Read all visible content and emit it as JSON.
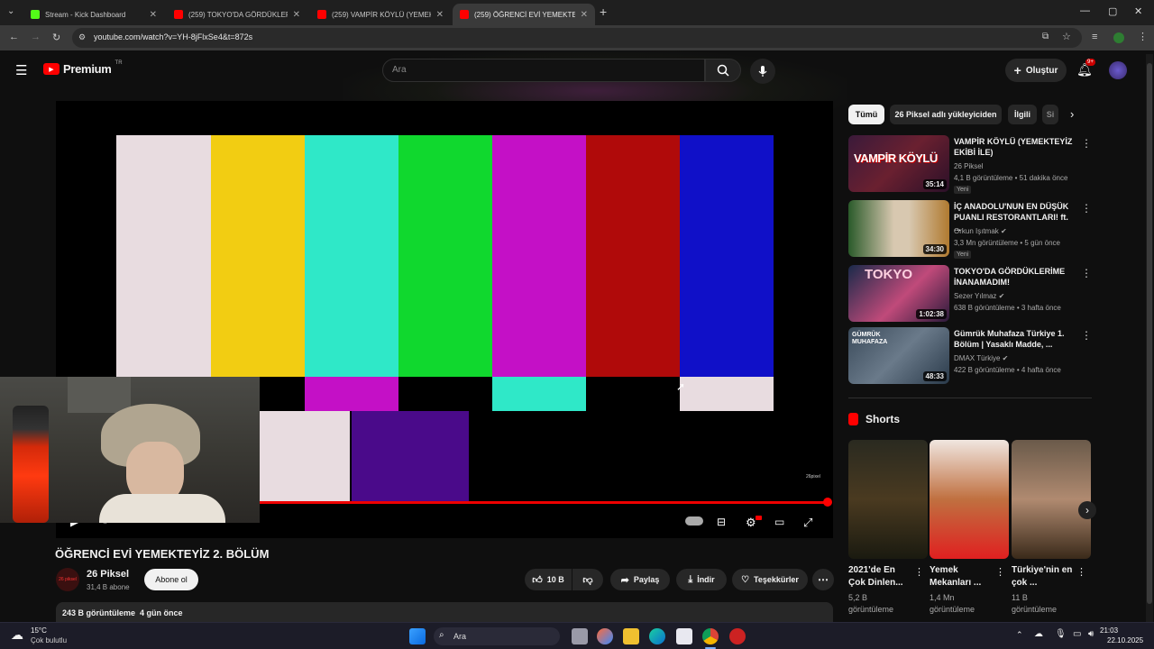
{
  "browser": {
    "tabs": [
      {
        "title": "Stream - Kick Dashboard",
        "favicon_color": "#53fc18"
      },
      {
        "title": "(259) TOKYO'DA GÖRDÜKLERİM",
        "favicon_color": "#ff0000"
      },
      {
        "title": "(259) VAMPİR KÖYLÜ (YEMEKTEYİ",
        "favicon_color": "#ff0000"
      },
      {
        "title": "(259) ÖĞRENCİ EVİ YEMEKTEYİZ",
        "favicon_color": "#ff0000"
      }
    ],
    "url": "youtube.com/watch?v=YH-8jFlxSe4&t=872s"
  },
  "youtube": {
    "logo_text": "Premium",
    "logo_badge": "TR",
    "search_placeholder": "Ara",
    "create_label": "Oluştur",
    "notif_count": "9+",
    "video": {
      "title": "ÖĞRENCİ EVİ YEMEKTEYİZ 2. BÖLÜM",
      "channel": "26 Piksel",
      "channel_avatar_text": "26 piksel",
      "subscribers": "31,4 B abone",
      "subscribe_label": "Abone ol",
      "likes": "10 B",
      "share_label": "Paylaş",
      "download_label": "İndir",
      "thanks_label": "Teşekkürler",
      "views_line": "243 B görüntüleme  4 gün önce",
      "watermark": "26pixel",
      "progress_percent": 100
    },
    "chips": [
      "Tümü",
      "26 Piksel adlı yükleyiciden",
      "İlgili",
      "Si"
    ],
    "recommendations": [
      {
        "title": "VAMPİR KÖYLÜ (YEMEKTEYİZ EKİBİ İLE)",
        "channel": "26 Piksel",
        "meta": "4,1 B görüntüleme • 51 dakika önce",
        "badge": "Yeni",
        "duration": "35:14",
        "thumb_text": "VAMPİR KÖYLÜ"
      },
      {
        "title": "İÇ ANADOLU'NUN EN DÜŞÜK PUANLI RESTORANTLARI! ft. ...",
        "channel": "Orkun Işıtmak",
        "meta": "3,3 Mn görüntüleme • 5 gün önce",
        "badge": "Yeni",
        "duration": "34:30",
        "thumb_text": ""
      },
      {
        "title": "TOKYO'DA GÖRDÜKLERİME İNANAMADIM!",
        "channel": "Sezer Yılmaz",
        "meta": "638 B görüntüleme • 3 hafta önce",
        "badge": "",
        "duration": "1:02:38",
        "thumb_text": "TOKYO"
      },
      {
        "title": "Gümrük Muhafaza Türkiye 1. Bölüm | Yasaklı Madde, ...",
        "channel": "DMAX Türkiye",
        "meta": "422 B görüntüleme • 4 hafta önce",
        "badge": "",
        "duration": "48:33",
        "thumb_text": "GÜMRÜK MUHAFAZA"
      }
    ],
    "shorts_label": "Shorts",
    "shorts": [
      {
        "title": "2021'de En Çok Dinlen...",
        "views": "5,2 B görüntüleme"
      },
      {
        "title": "Yemek Mekanları ...",
        "views": "1,4 Mn görüntüleme"
      },
      {
        "title": "Türkiye'nin en çok ...",
        "views": "11 B görüntüleme"
      }
    ]
  },
  "taskbar": {
    "weather_temp": "15°C",
    "weather_desc": "Çok bulutlu",
    "search_label": "Ara",
    "time": "21:03",
    "date": "22.10.2025"
  },
  "colors": {
    "accent": "#ff0000",
    "bg": "#0f0f0f"
  }
}
